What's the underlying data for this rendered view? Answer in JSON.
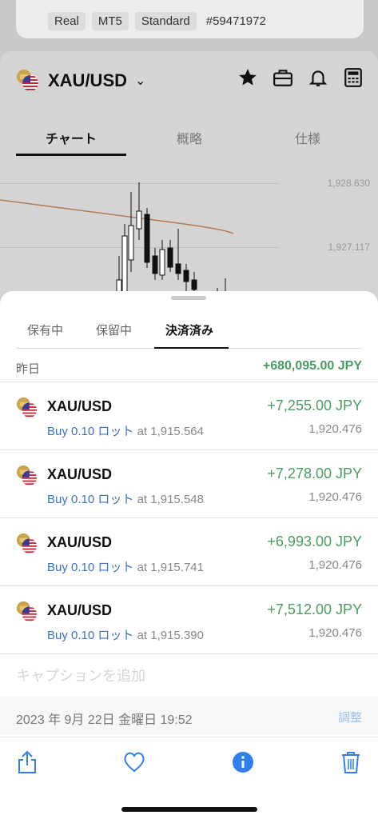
{
  "account": {
    "tags": [
      "Real",
      "MT5",
      "Standard"
    ],
    "id": "#59471972"
  },
  "header": {
    "symbol": "XAU/USD",
    "icons": [
      "star-icon",
      "briefcase-icon",
      "bell-icon",
      "calculator-icon"
    ]
  },
  "chart_tabs": [
    "チャート",
    "概略",
    "仕様"
  ],
  "price_labels": [
    "1,928.630",
    "1,927.117"
  ],
  "sheet": {
    "tabs": [
      "保有中",
      "保留中",
      "決済済み"
    ],
    "day": {
      "label": "昨日",
      "total": "+680,095.00 JPY"
    },
    "trades": [
      {
        "symbol": "XAU/USD",
        "pl": "+7,255.00 JPY",
        "side": "Buy 0.10 ロット",
        "open": "at 1,915.564",
        "close": "1,920.476"
      },
      {
        "symbol": "XAU/USD",
        "pl": "+7,278.00 JPY",
        "side": "Buy 0.10 ロット",
        "open": "at 1,915.548",
        "close": "1,920.476"
      },
      {
        "symbol": "XAU/USD",
        "pl": "+6,993.00 JPY",
        "side": "Buy 0.10 ロット",
        "open": "at 1,915.741",
        "close": "1,920.476"
      },
      {
        "symbol": "XAU/USD",
        "pl": "+7,512.00 JPY",
        "side": "Buy 0.10 ロット",
        "open": "at 1,915.390",
        "close": "1,920.476"
      }
    ],
    "caption_placeholder": "キャプションを追加",
    "date": "2023 年 9月 22日 金曜日 19:52",
    "adjust": "調整"
  },
  "colors": {
    "profit": "#4a9d62",
    "buy": "#3a72c3",
    "accent": "#2f80ed"
  }
}
